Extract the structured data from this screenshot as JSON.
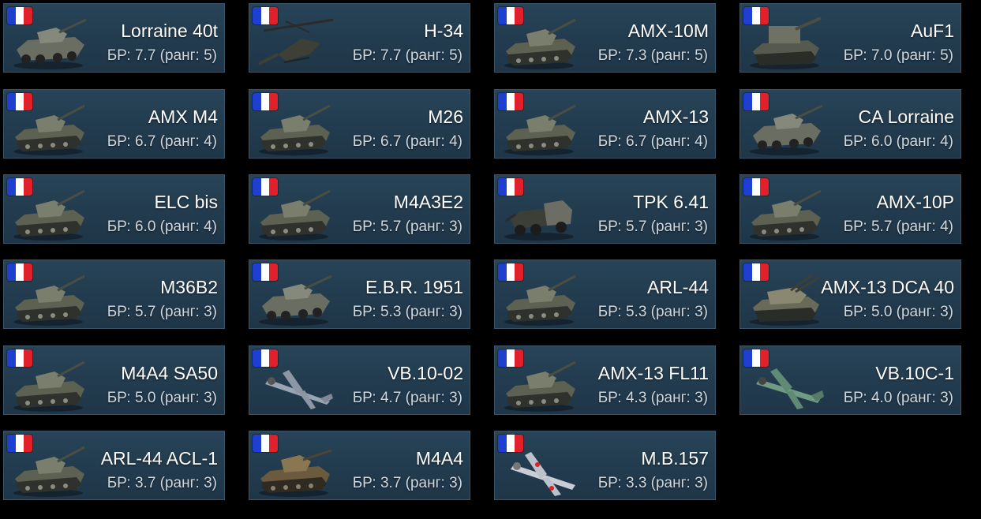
{
  "vehicles": [
    {
      "name": "Lorraine 40t",
      "br": "БР: 7.7 (ранг: 5)",
      "kind": "wheeled-tank-icon"
    },
    {
      "name": "H-34",
      "br": "БР: 7.7 (ранг: 5)",
      "kind": "helicopter-icon"
    },
    {
      "name": "AMX-10M",
      "br": "БР: 7.3 (ранг: 5)",
      "kind": "tank-icon"
    },
    {
      "name": "AuF1",
      "br": "БР: 7.0 (ранг: 5)",
      "kind": "spg-icon"
    },
    {
      "name": "AMX M4",
      "br": "БР: 6.7 (ранг: 4)",
      "kind": "tank-icon"
    },
    {
      "name": "M26",
      "br": "БР: 6.7 (ранг: 4)",
      "kind": "tank-icon"
    },
    {
      "name": "AMX-13",
      "br": "БР: 6.7 (ранг: 4)",
      "kind": "tank-icon"
    },
    {
      "name": "CA Lorraine",
      "br": "БР: 6.0 (ранг: 4)",
      "kind": "wheeled-tank-icon"
    },
    {
      "name": "ELC bis",
      "br": "БР: 6.0 (ранг: 4)",
      "kind": "tank-icon"
    },
    {
      "name": "M4A3E2",
      "br": "БР: 5.7 (ранг: 3)",
      "kind": "tank-icon"
    },
    {
      "name": "TPK 6.41",
      "br": "БР: 5.7 (ранг: 3)",
      "kind": "truck-icon"
    },
    {
      "name": "AMX-10P",
      "br": "БР: 5.7 (ранг: 4)",
      "kind": "tank-icon"
    },
    {
      "name": "M36B2",
      "br": "БР: 5.7 (ранг: 3)",
      "kind": "tank-icon"
    },
    {
      "name": "E.B.R. 1951",
      "br": "БР: 5.3 (ранг: 3)",
      "kind": "wheeled-tank-icon"
    },
    {
      "name": "ARL-44",
      "br": "БР: 5.3 (ранг: 3)",
      "kind": "tank-icon"
    },
    {
      "name": "AMX-13 DCA 40",
      "br": "БР: 5.0 (ранг: 3)",
      "kind": "spaa-icon"
    },
    {
      "name": "M4A4 SA50",
      "br": "БР: 5.0 (ранг: 3)",
      "kind": "tank-icon"
    },
    {
      "name": "VB.10-02",
      "br": "БР: 4.7 (ранг: 3)",
      "kind": "plane-icon"
    },
    {
      "name": "AMX-13 FL11",
      "br": "БР: 4.3 (ранг: 3)",
      "kind": "tank-icon"
    },
    {
      "name": "VB.10C-1",
      "br": "БР: 4.0 (ранг: 3)",
      "kind": "plane-green-icon"
    },
    {
      "name": "ARL-44 ACL-1",
      "br": "БР: 3.7 (ранг: 3)",
      "kind": "tank-icon"
    },
    {
      "name": "M4A4",
      "br": "БР: 3.7 (ранг: 3)",
      "kind": "tank-brown-icon"
    },
    {
      "name": "M.B.157",
      "br": "БР: 3.3 (ранг: 3)",
      "kind": "plane-light-icon"
    }
  ],
  "colors": {
    "card_bg": "#233d50",
    "card_border": "#3a5568",
    "name_text": "#ffffff",
    "br_text": "#cfd8df",
    "flag": [
      "#1f3fd0",
      "#ffffff",
      "#e0202b"
    ]
  }
}
